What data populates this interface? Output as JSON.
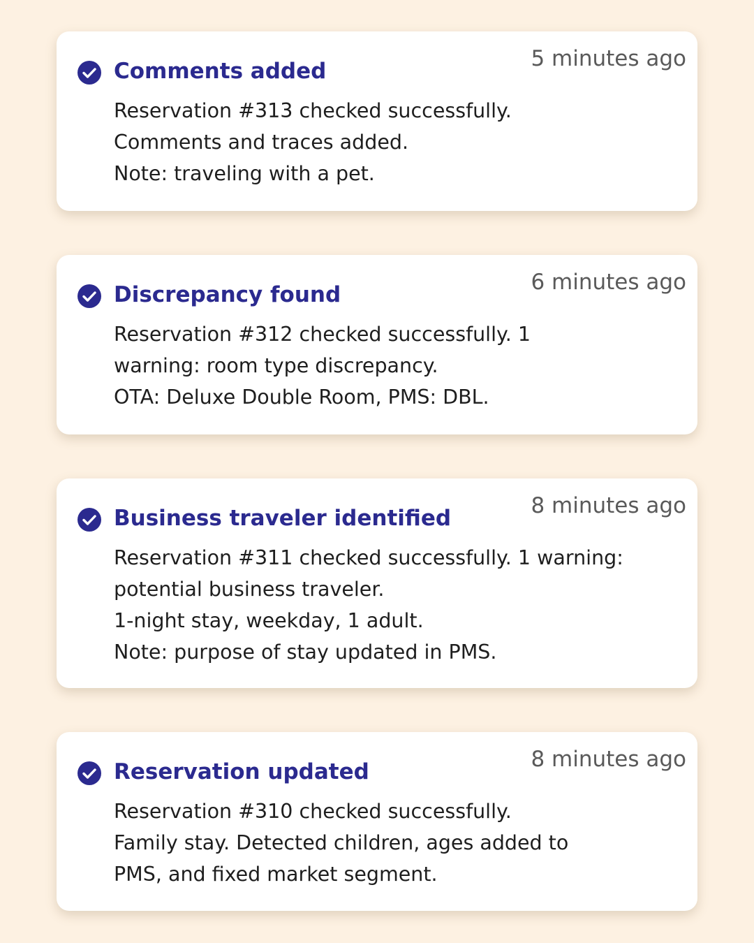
{
  "accent_color": "#2b2a8f",
  "background_color": "#fdf1e2",
  "notifications": [
    {
      "icon": "check-circle-icon",
      "title": "Comments added",
      "time": "5 minutes ago",
      "lines": [
        "Reservation #313 checked successfully.",
        "Comments and traces added.",
        "Note: traveling with a pet."
      ]
    },
    {
      "icon": "check-circle-icon",
      "title": "Discrepancy found",
      "time": "6 minutes ago",
      "lines": [
        "Reservation #312 checked successfully. 1",
        "warning: room type discrepancy.",
        "OTA: Deluxe Double Room, PMS: DBL."
      ]
    },
    {
      "icon": "check-circle-icon",
      "title": "Business traveler identified",
      "time": "8 minutes ago",
      "lines": [
        "Reservation #311 checked successfully. 1 warning:",
        "potential business traveler.",
        "1-night stay, weekday, 1 adult.",
        "Note: purpose of stay updated in PMS."
      ]
    },
    {
      "icon": "check-circle-icon",
      "title": "Reservation updated",
      "time": "8 minutes ago",
      "lines": [
        "Reservation #310 checked successfully.",
        "Family stay. Detected children, ages added to",
        "PMS, and fixed market segment."
      ]
    }
  ]
}
